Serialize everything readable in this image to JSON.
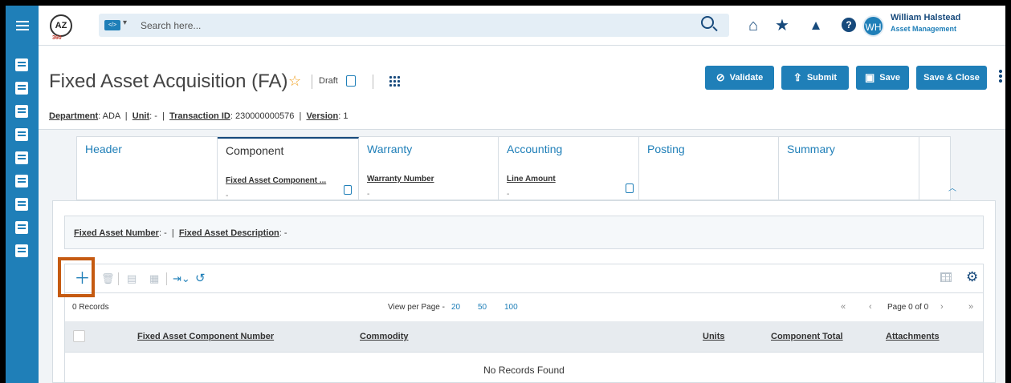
{
  "search": {
    "placeholder": "Search here...",
    "chip": "</>",
    "caret": "▾"
  },
  "logo": {
    "text": "AZ",
    "sub": "360"
  },
  "user": {
    "initials": "WH",
    "name": "William Halstead",
    "org": "Asset Management"
  },
  "page": {
    "title": "Fixed Asset Acquisition (FA)",
    "status": "Draft",
    "meta": {
      "department_label": "Department",
      "department": "ADA",
      "unit_label": "Unit",
      "unit": "-",
      "txn_label": "Transaction ID",
      "txn": "230000000576",
      "version_label": "Version",
      "version": "1"
    }
  },
  "actions": {
    "validate": "Validate",
    "submit": "Submit",
    "save": "Save",
    "save_close": "Save & Close"
  },
  "tabs": [
    {
      "label": "Header"
    },
    {
      "label": "Component",
      "field": "Fixed Asset Component ...",
      "value": "-"
    },
    {
      "label": "Warranty",
      "field": "Warranty Number",
      "value": "-"
    },
    {
      "label": "Accounting",
      "field": "Line Amount",
      "value": "-"
    },
    {
      "label": "Posting"
    },
    {
      "label": "Summary"
    }
  ],
  "infobar": {
    "fa_number_label": "Fixed Asset Number",
    "fa_number": "-",
    "fa_desc_label": "Fixed Asset Description",
    "fa_desc": "-"
  },
  "grid": {
    "records": "0 Records",
    "view_per_page": "View per Page -",
    "page_sizes": [
      "20",
      "50",
      "100"
    ],
    "page_info": "Page 0 of 0",
    "columns": [
      "Fixed Asset Component Number",
      "Commodity",
      "Units",
      "Component Total",
      "Attachments"
    ],
    "empty": "No Records Found"
  }
}
